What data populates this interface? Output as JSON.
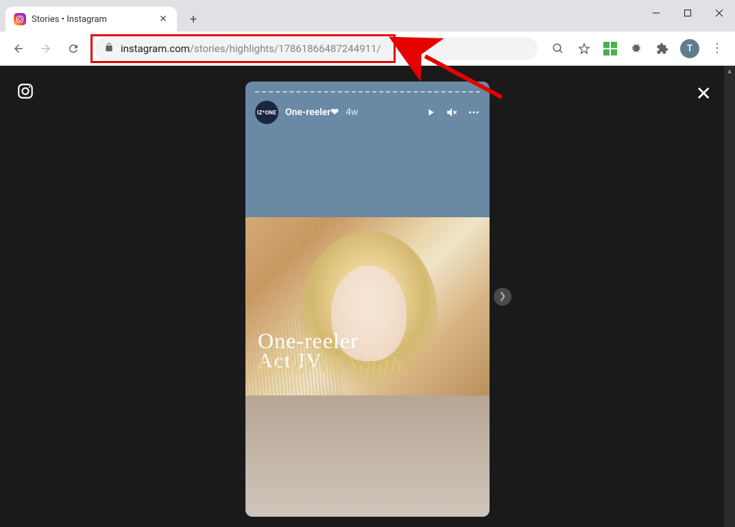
{
  "window": {
    "tab_title": "Stories • Instagram",
    "avatar_letter": "T"
  },
  "url": {
    "host": "instagram.com",
    "path": "/stories/highlights/17861866487244911/"
  },
  "story": {
    "avatar_label": "IZ*ONE",
    "username": "One-reeler❤",
    "time": "4w",
    "overlay_line1": "One-reeler",
    "overlay_line2": "Act IV",
    "overlay_script": "Color of Youth"
  }
}
